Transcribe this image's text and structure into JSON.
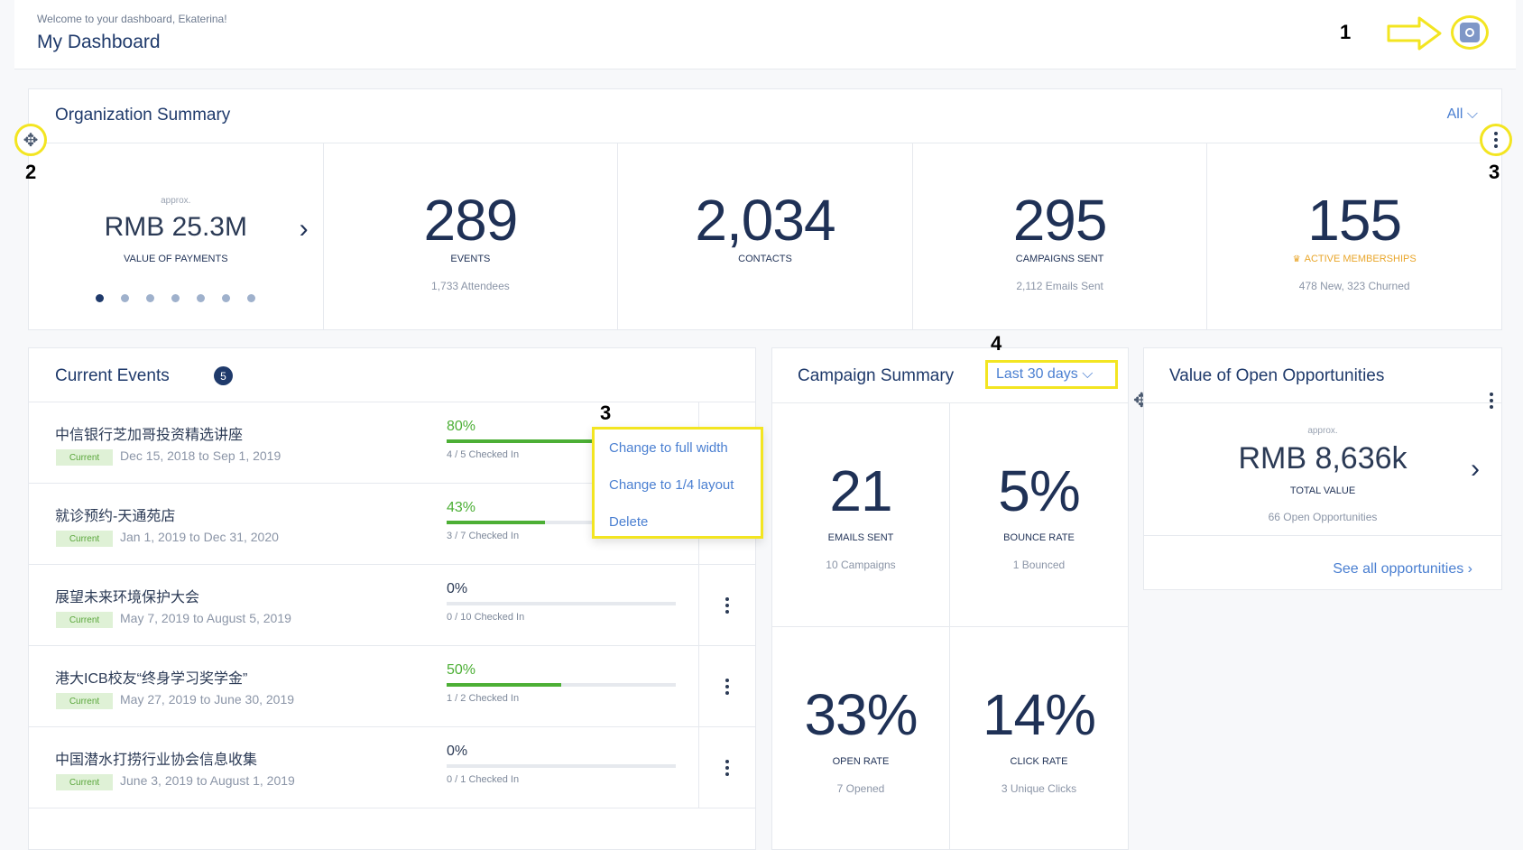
{
  "header": {
    "welcome": "Welcome to your dashboard, Ekaterina!",
    "title": "My Dashboard",
    "settings_icon": "gear-icon"
  },
  "annotations": [
    "1",
    "2",
    "3",
    "3",
    "4"
  ],
  "org_summary": {
    "title": "Organization Summary",
    "filter": "All",
    "payments": {
      "approx": "approx.",
      "value": "RMB 25.3M",
      "label": "VALUE OF PAYMENTS"
    },
    "events": {
      "value": "289",
      "label": "EVENTS",
      "sub": "1,733 Attendees"
    },
    "contacts": {
      "value": "2,034",
      "label": "CONTACTS"
    },
    "campaigns": {
      "value": "295",
      "label": "CAMPAIGNS SENT",
      "sub": "2,112 Emails Sent"
    },
    "memberships": {
      "value": "155",
      "label": "ACTIVE MEMBERSHIPS",
      "sub": "478 New, 323 Churned",
      "accent": "#e9a62b"
    },
    "carousel_total": 7,
    "carousel_active": 1
  },
  "current_events": {
    "title": "Current Events",
    "count": "5",
    "rows": [
      {
        "name": "中信银行芝加哥投资精选讲座",
        "status": "Current",
        "dates": "Dec 15, 2018 to Sep 1, 2019",
        "pct": "80%",
        "fill": 0.8,
        "checked": "4 / 5 Checked In"
      },
      {
        "name": "就诊预约-天通苑店",
        "status": "Current",
        "dates": "Jan 1, 2019 to Dec 31, 2020",
        "pct": "43%",
        "fill": 0.43,
        "checked": "3 / 7 Checked In"
      },
      {
        "name": "展望未来环境保护大会",
        "status": "Current",
        "dates": "May 7, 2019 to August 5, 2019",
        "pct": "0%",
        "fill": 0,
        "checked": "0 / 10 Checked In"
      },
      {
        "name": "港大ICB校友“终身学习奖学金”",
        "status": "Current",
        "dates": "May 27, 2019 to June 30, 2019",
        "pct": "50%",
        "fill": 0.5,
        "checked": "1 / 2 Checked In"
      },
      {
        "name": "中国潜水打捞行业协会信息收集",
        "status": "Current",
        "dates": "June 3, 2019 to August 1, 2019",
        "pct": "0%",
        "fill": 0,
        "checked": "0 / 1 Checked In"
      }
    ]
  },
  "context_menu": {
    "items": [
      "Change to full width",
      "Change to 1/4 layout",
      "Delete"
    ]
  },
  "campaign_summary": {
    "title": "Campaign Summary",
    "range": "Last 30 days",
    "metrics": [
      {
        "value": "21",
        "label": "EMAILS SENT",
        "sub": "10 Campaigns"
      },
      {
        "value": "5%",
        "label": "BOUNCE RATE",
        "sub": "1 Bounced"
      },
      {
        "value": "33%",
        "label": "OPEN RATE",
        "sub": "7 Opened"
      },
      {
        "value": "14%",
        "label": "CLICK RATE",
        "sub": "3 Unique Clicks"
      }
    ]
  },
  "opportunities": {
    "title": "Value of Open Opportunities",
    "approx": "approx.",
    "value": "RMB 8,636k",
    "label": "TOTAL VALUE",
    "sub": "66 Open Opportunities",
    "link": "See all opportunities"
  },
  "colors": {
    "highlight": "#f3e521",
    "accent_blue": "#4a7fd1",
    "success": "#4caf35",
    "navy": "#1f3a6b"
  }
}
